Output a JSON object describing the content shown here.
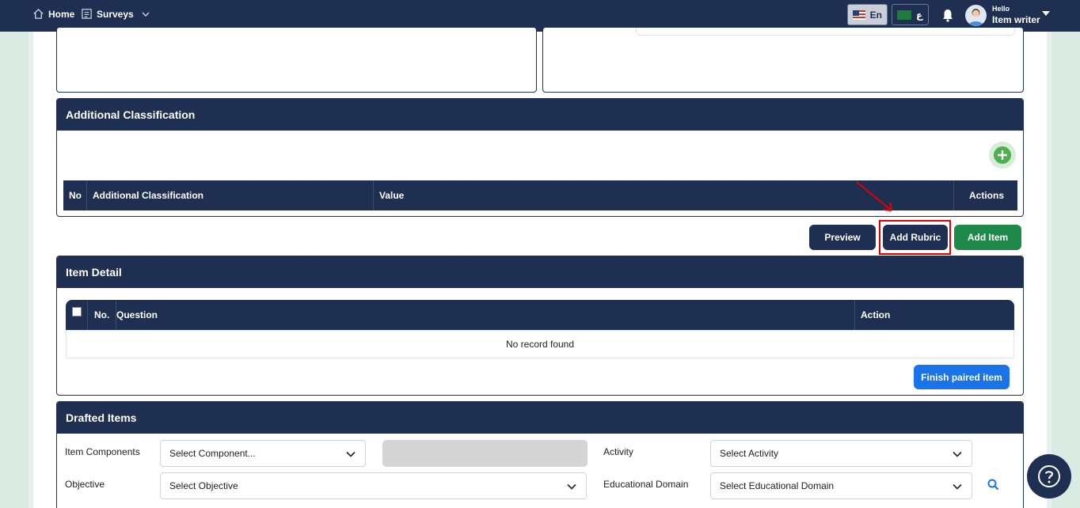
{
  "nav": {
    "home_label": "Home",
    "surveys_label": "Surveys",
    "lang_en": "En",
    "lang_ar": "ع",
    "hello": "Hello",
    "username": "Item writer"
  },
  "additional_classification": {
    "title": "Additional Classification",
    "columns": [
      "No",
      "Additional Classification",
      "Value",
      "Actions"
    ]
  },
  "actions": {
    "preview": "Preview",
    "add_rubric": "Add Rubric",
    "add_item": "Add Item"
  },
  "item_detail": {
    "title": "Item Detail",
    "columns": [
      "No.",
      "Question",
      "Action"
    ],
    "empty_text": "No record found",
    "finish_button": "Finish paired item"
  },
  "drafted_items": {
    "title": "Drafted Items",
    "item_components_label": "Item Components",
    "item_components_value": "Select Component...",
    "activity_label": "Activity",
    "activity_value": "Select Activity",
    "objective_label": "Objective",
    "objective_value": "Select Objective",
    "educational_domain_label": "Educational Domain",
    "educational_domain_value": "Select Educational Domain"
  },
  "colors": {
    "navy": "#1f2f52",
    "green": "#1e8a4a",
    "blue": "#1a73e8",
    "highlight": "#e00000"
  },
  "icons": [
    "home-icon",
    "survey-icon",
    "chevron-down-icon",
    "us-flag-icon",
    "sa-flag-icon",
    "bell-icon",
    "avatar",
    "plus-icon",
    "search-icon",
    "help-icon"
  ]
}
